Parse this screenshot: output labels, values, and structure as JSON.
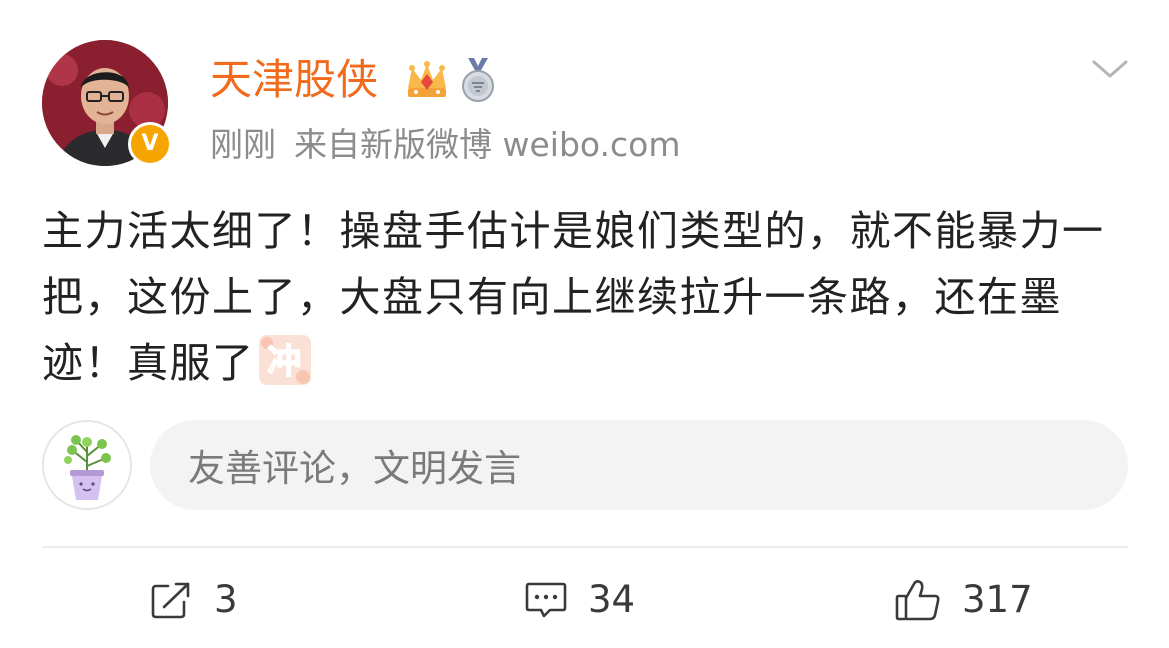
{
  "post": {
    "author": {
      "name": "天津股侠",
      "verified_badge": "V",
      "avatar_icon": "user-photo",
      "badges": [
        "crown-icon",
        "medal-icon"
      ]
    },
    "time": "刚刚",
    "source": "来自新版微博 weibo.com",
    "text": "主力活太细了！操盘手估计是娘们类型的，就不能暴力一把，这份上了，大盘只有向上继续拉升一条路，还在墨迹！真服了",
    "emoji_text": "冲",
    "menu_icon": "chevron-down-icon"
  },
  "comment_box": {
    "placeholder": "友善评论，文明发言",
    "avatar_icon": "potted-plant-icon"
  },
  "actions": {
    "repost_count": "3",
    "comment_count": "34",
    "like_count": "317"
  },
  "colors": {
    "username": "#f26a1b",
    "meta": "#8c8c8c",
    "text": "#222222",
    "input_bg": "#f3f3f3",
    "badge": "#f6a400"
  }
}
